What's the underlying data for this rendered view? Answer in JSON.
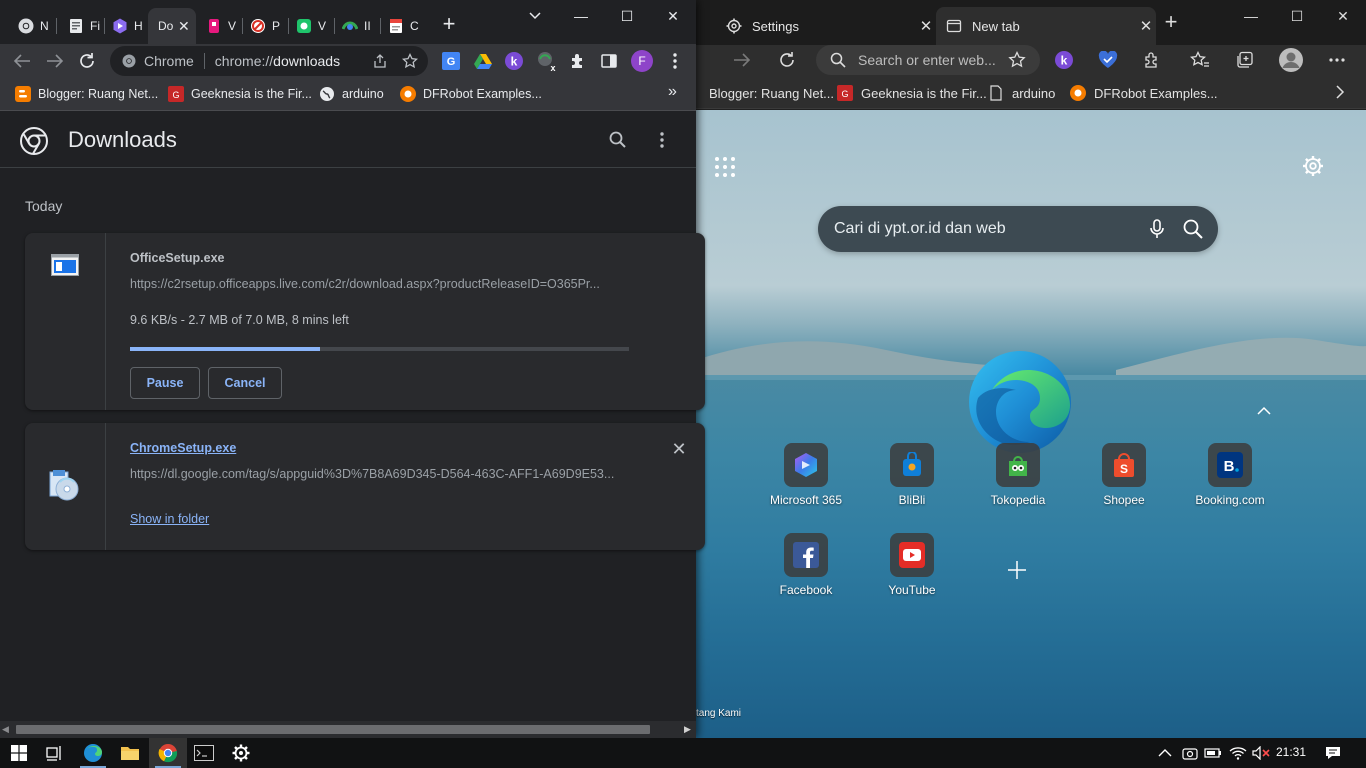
{
  "edge": {
    "tabs": [
      {
        "label": "Settings",
        "icon": "gear-icon"
      },
      {
        "label": "New tab",
        "icon": "newtab-icon"
      }
    ],
    "address_placeholder": "Search or enter web...",
    "bookmarks": [
      {
        "label": "Blogger: Ruang Net...",
        "icon": "blogger-icon"
      },
      {
        "label": "Geeknesia is the Fir...",
        "icon": "geeknesia-icon"
      },
      {
        "label": "arduino",
        "icon": "page-icon"
      },
      {
        "label": "DFRobot Examples...",
        "icon": "dfrobot-icon"
      }
    ],
    "ntp": {
      "search_placeholder": "Cari di ypt.or.id dan web",
      "tiles": [
        {
          "label": "Microsoft 365",
          "icon": "microsoft365-icon"
        },
        {
          "label": "BliBli",
          "icon": "blibli-icon"
        },
        {
          "label": "Tokopedia",
          "icon": "tokopedia-icon"
        },
        {
          "label": "Shopee",
          "icon": "shopee-icon"
        },
        {
          "label": "Booking.com",
          "icon": "booking-icon"
        },
        {
          "label": "Facebook",
          "icon": "facebook-icon"
        },
        {
          "label": "YouTube",
          "icon": "youtube-icon"
        }
      ],
      "footer": "tang Kami"
    }
  },
  "chrome": {
    "tabs": [
      {
        "label": "N",
        "icon": "chrome-icon"
      },
      {
        "label": "Fi",
        "icon": "doc-icon"
      },
      {
        "label": "H",
        "icon": "hexagon-icon"
      },
      {
        "label": "Do",
        "icon": "download-tab-icon",
        "active": true
      },
      {
        "label": "V",
        "icon": "figma-icon"
      },
      {
        "label": "P",
        "icon": "blocked-icon"
      },
      {
        "label": "V",
        "icon": "green-app-icon"
      },
      {
        "label": "II",
        "icon": "colorful-icon"
      },
      {
        "label": "C",
        "icon": "form-icon"
      }
    ],
    "omnibox": {
      "chip": "Chrome",
      "url_prefix": "chrome://",
      "url_host": "downloads"
    },
    "profile_initial": "F",
    "bookmarks": [
      {
        "label": "Blogger: Ruang Net...",
        "icon": "blogger-icon"
      },
      {
        "label": "Geeknesia is the Fir...",
        "icon": "geeknesia-icon"
      },
      {
        "label": "arduino",
        "icon": "globe-icon"
      },
      {
        "label": "DFRobot Examples...",
        "icon": "dfrobot-icon"
      }
    ],
    "bookmarks_overflow": "»",
    "downloads": {
      "title": "Downloads",
      "date_group": "Today",
      "items": [
        {
          "filename": "OfficeSetup.exe",
          "url": "https://c2rsetup.officeapps.live.com/c2r/download.aspx?productReleaseID=O365Pr...",
          "status": "9.6 KB/s - 2.7 MB of 7.0 MB, 8 mins left",
          "progress": 0.38,
          "buttons": [
            "Pause",
            "Cancel"
          ]
        },
        {
          "filename": "ChromeSetup.exe",
          "url": "https://dl.google.com/tag/s/appguid%3D%7B8A69D345-D564-463C-AFF1-A69D9E53...",
          "action": "Show in folder"
        }
      ]
    }
  },
  "taskbar": {
    "clock": "21:31",
    "apps": [
      "windows-start-icon",
      "task-view-icon",
      "edge-icon",
      "file-explorer-icon",
      "chrome-icon",
      "terminal-icon",
      "settings-icon"
    ]
  },
  "colors": {
    "chrome_bg": "#202124",
    "chrome_toolbar": "#35363a",
    "accent_blue": "#8ab4f8",
    "edge_bg": "#202020"
  }
}
